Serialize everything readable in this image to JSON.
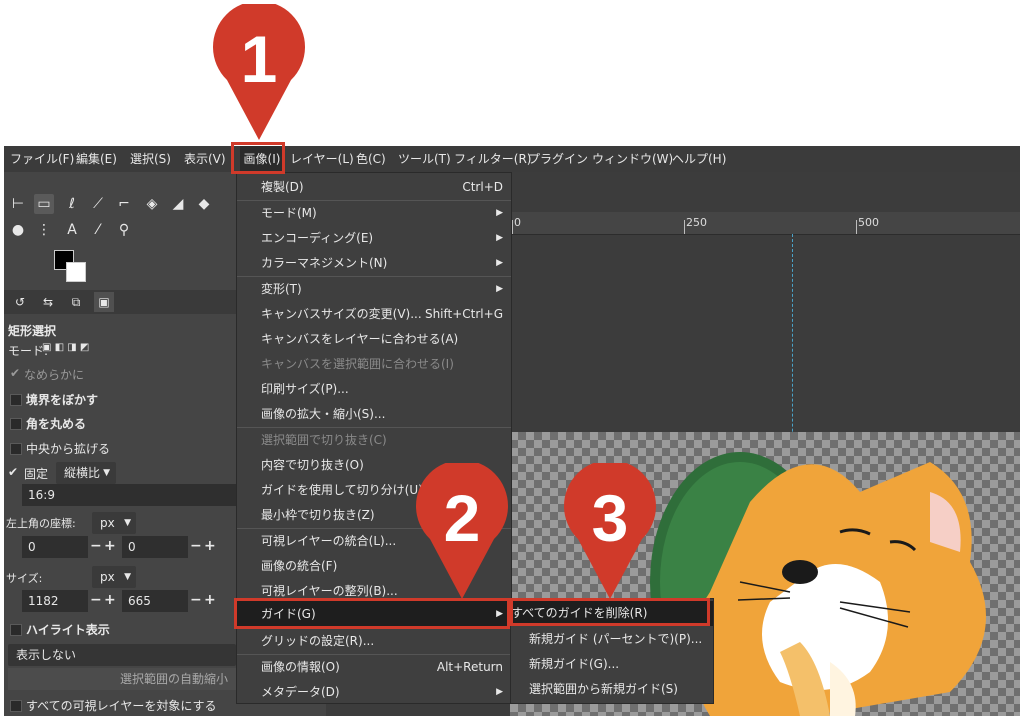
{
  "menubar": {
    "items": [
      "ファイル(F)",
      "編集(E)",
      "選択(S)",
      "表示(V)",
      "画像(I)",
      "レイヤー(L)",
      "色(C)",
      "ツール(T)",
      "フィルター(R)",
      "プラグイン",
      "ウィンドウ(W)",
      "ヘルプ(H)"
    ]
  },
  "tool_options": {
    "title": "矩形選択",
    "mode_label": "モード:",
    "antialias": "なめらかに",
    "feather": "境界をぼかす",
    "rounded": "角を丸める",
    "expand_center": "中央から拡げる",
    "fixed": "固定",
    "fixed_value": "縦横比",
    "ratio": "16:9",
    "position_label": "左上角の座標:",
    "position_unit": "px",
    "pos_x": "0",
    "pos_y": "0",
    "size_label": "サイズ:",
    "size_unit": "px",
    "width": "1182",
    "height": "665",
    "highlight": "ハイライト表示",
    "guides_value": "表示しない",
    "auto_shrink": "選択範囲の自動縮小",
    "sample_merged": "すべての可視レイヤーを対象にする"
  },
  "ruler": {
    "labels": [
      "0",
      "250",
      "500"
    ]
  },
  "image_menu": {
    "items": [
      {
        "label": "複製(D)",
        "shortcut": "Ctrl+D",
        "arrow": "",
        "disabled": false
      },
      {
        "label": "モード(M)",
        "shortcut": "",
        "arrow": "▶",
        "disabled": false
      },
      {
        "label": "エンコーディング(E)",
        "shortcut": "",
        "arrow": "▶",
        "disabled": false
      },
      {
        "label": "カラーマネジメント(N)",
        "shortcut": "",
        "arrow": "▶",
        "disabled": false
      },
      {
        "label": "変形(T)",
        "shortcut": "",
        "arrow": "▶",
        "disabled": false
      },
      {
        "label": "キャンバスサイズの変更(V)...",
        "shortcut": "Shift+Ctrl+G",
        "arrow": "",
        "disabled": false
      },
      {
        "label": "キャンバスをレイヤーに合わせる(A)",
        "shortcut": "",
        "arrow": "",
        "disabled": false
      },
      {
        "label": "キャンバスを選択範囲に合わせる(I)",
        "shortcut": "",
        "arrow": "",
        "disabled": true
      },
      {
        "label": "印刷サイズ(P)...",
        "shortcut": "",
        "arrow": "",
        "disabled": false
      },
      {
        "label": "画像の拡大・縮小(S)...",
        "shortcut": "",
        "arrow": "",
        "disabled": false
      },
      {
        "label": "選択範囲で切り抜き(C)",
        "shortcut": "",
        "arrow": "",
        "disabled": true
      },
      {
        "label": "内容で切り抜き(O)",
        "shortcut": "",
        "arrow": "",
        "disabled": false
      },
      {
        "label": "ガイドを使用して切り分け(U)",
        "shortcut": "",
        "arrow": "",
        "disabled": false
      },
      {
        "label": "最小枠で切り抜き(Z)",
        "shortcut": "",
        "arrow": "",
        "disabled": false
      },
      {
        "label": "可視レイヤーの統合(L)...",
        "shortcut": "",
        "arrow": "",
        "disabled": false
      },
      {
        "label": "画像の統合(F)",
        "shortcut": "",
        "arrow": "",
        "disabled": false
      },
      {
        "label": "可視レイヤーの整列(B)...",
        "shortcut": "",
        "arrow": "",
        "disabled": false
      },
      {
        "label": "ガイド(G)",
        "shortcut": "",
        "arrow": "▶",
        "disabled": false
      },
      {
        "label": "グリッドの設定(R)...",
        "shortcut": "",
        "arrow": "",
        "disabled": false
      },
      {
        "label": "画像の情報(O)",
        "shortcut": "Alt+Return",
        "arrow": "",
        "disabled": false
      },
      {
        "label": "メタデータ(D)",
        "shortcut": "",
        "arrow": "▶",
        "disabled": false
      }
    ]
  },
  "guides_submenu": {
    "items": [
      "すべてのガイドを削除(R)",
      "新規ガイド (パーセントで)(P)...",
      "新規ガイド(G)...",
      "選択範囲から新規ガイド(S)"
    ]
  },
  "callouts": [
    "1",
    "2",
    "3"
  ],
  "colors": {
    "callout": "#d03a2a",
    "menu_bg": "#3f3f3f",
    "highlight_row": "#1e1e1e"
  }
}
